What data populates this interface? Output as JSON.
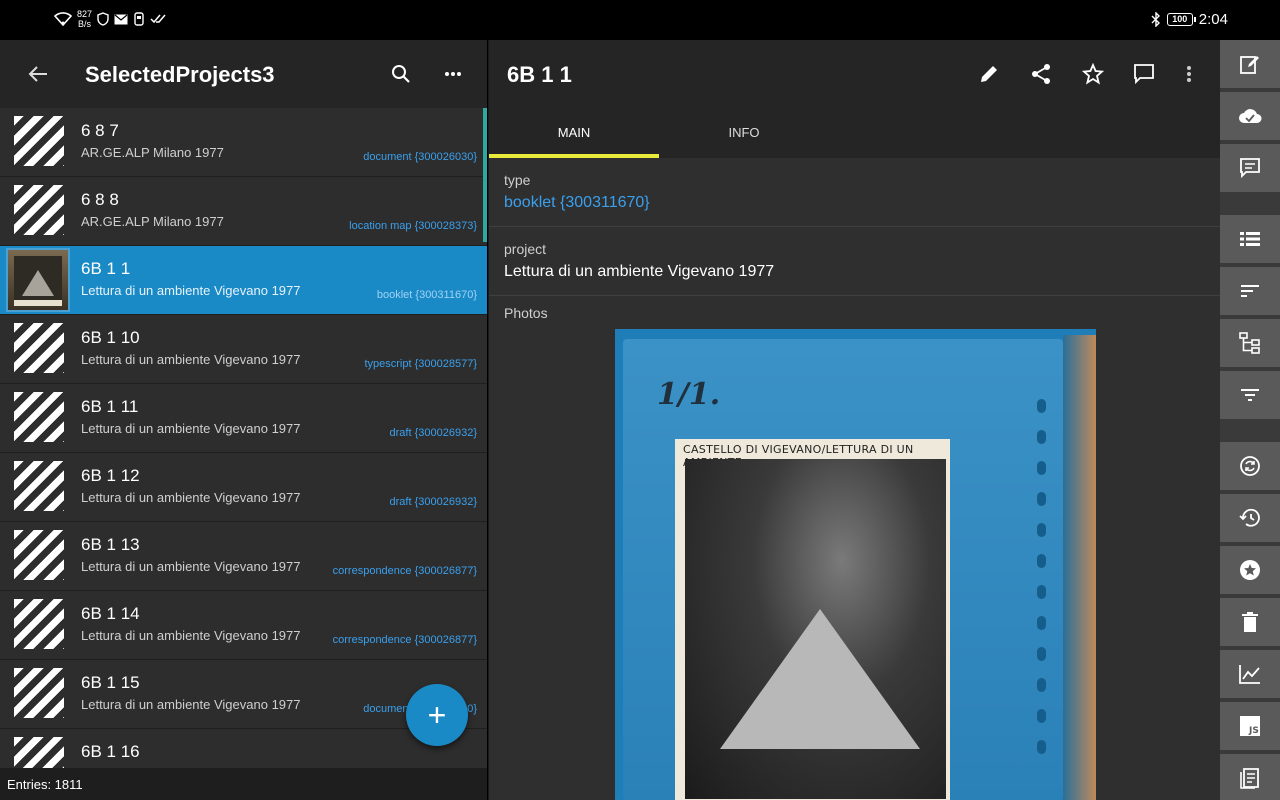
{
  "status_bar": {
    "net_speed_value": "827",
    "net_speed_unit": "B/s",
    "battery": "100",
    "time": "2:04"
  },
  "list_panel": {
    "title": "SelectedProjects3",
    "entries_label": "Entries: 1811",
    "items": [
      {
        "title": "6 8 7",
        "subtitle": "AR.GE.ALP Milano 1977",
        "type": "document {300026030}"
      },
      {
        "title": "6 8 8",
        "subtitle": "AR.GE.ALP Milano 1977",
        "type": "location map {300028373}"
      },
      {
        "title": "6B 1 1",
        "subtitle": "Lettura di un ambiente Vigevano 1977",
        "type": "booklet {300311670}"
      },
      {
        "title": "6B 1 10",
        "subtitle": "Lettura di un ambiente Vigevano 1977",
        "type": "typescript {300028577}"
      },
      {
        "title": "6B 1 11",
        "subtitle": "Lettura di un ambiente Vigevano 1977",
        "type": "draft {300026932}"
      },
      {
        "title": "6B 1 12",
        "subtitle": "Lettura di un ambiente Vigevano 1977",
        "type": "draft {300026932}"
      },
      {
        "title": "6B 1 13",
        "subtitle": "Lettura di un ambiente Vigevano 1977",
        "type": "correspondence {300026877}"
      },
      {
        "title": "6B 1 14",
        "subtitle": "Lettura di un ambiente Vigevano 1977",
        "type": "correspondence {300026877}"
      },
      {
        "title": "6B 1 15",
        "subtitle": "Lettura di un ambiente Vigevano 1977",
        "type": "document {300026030}"
      },
      {
        "title": "6B 1 16",
        "subtitle": "",
        "type": ""
      }
    ],
    "fab_label": "+"
  },
  "detail": {
    "title": "6B 1 1",
    "tabs": [
      {
        "label": "MAIN"
      },
      {
        "label": "INFO"
      }
    ],
    "fields": {
      "type_label": "type",
      "type_value": "booklet {300311670}",
      "project_label": "project",
      "project_value": "Lettura di un ambiente Vigevano 1977",
      "photos_label": "Photos"
    },
    "photo": {
      "handwriting": "1/1.",
      "booklet_title": "CASTELLO DI VIGEVANO/LETTURA DI UN AMBIENTE"
    }
  },
  "colors": {
    "accent": "#1a8ac6",
    "tab_indicator": "#e8ea3c",
    "link": "#3aa0ee"
  }
}
